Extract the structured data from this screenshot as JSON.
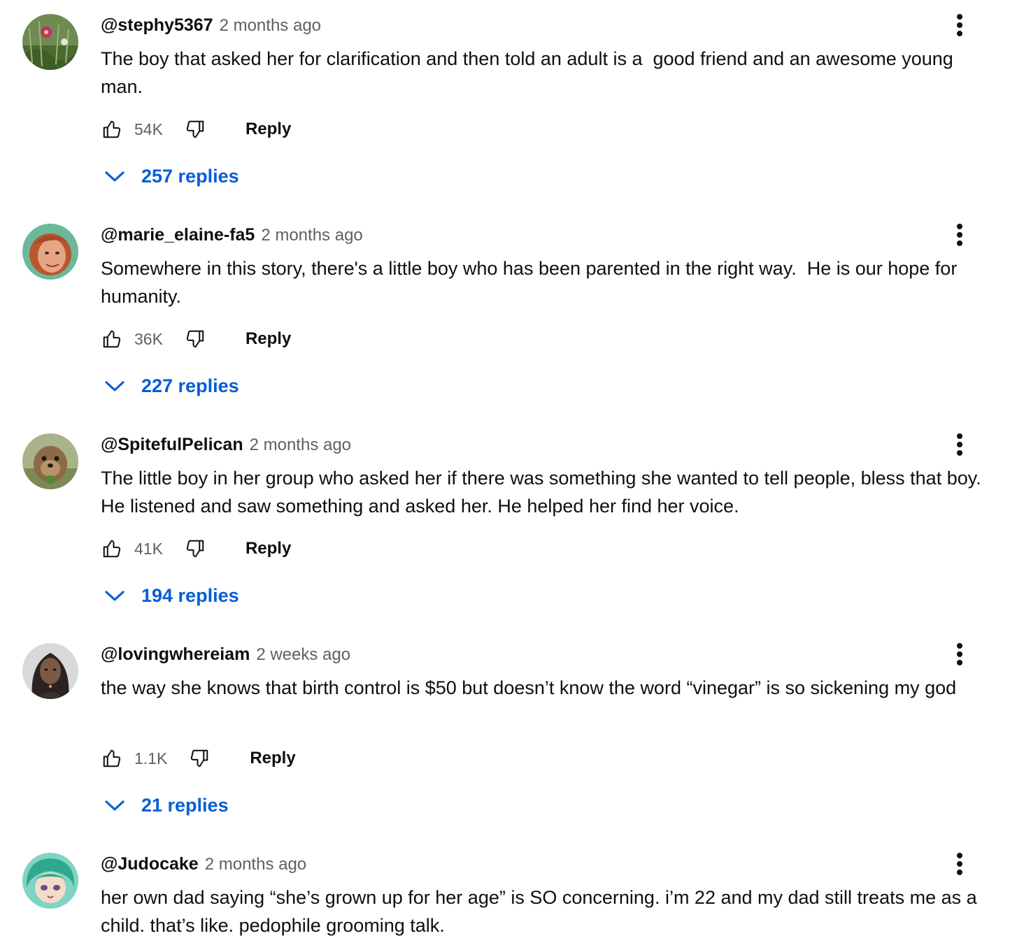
{
  "colors": {
    "text": "#0f0f0f",
    "secondary_text": "#606060",
    "link_blue": "#065fd4",
    "background": "#ffffff"
  },
  "icons": {
    "like": "thumb-up-outline",
    "dislike": "thumb-down-outline",
    "menu": "three-dot-vertical",
    "expand": "chevron-down"
  },
  "comments": [
    {
      "author": "@stephy5367",
      "time": "2 months ago",
      "text": "The boy that asked her for clarification and then told an adult is a  good friend and an awesome young man.",
      "likes": "54K",
      "reply_label": "Reply",
      "replies_label": "257 replies"
    },
    {
      "author": "@marie_elaine-fa5",
      "time": "2 months ago",
      "text": "Somewhere in this story, there's a little boy who has been parented in the right way.  He is our hope for humanity.",
      "likes": "36K",
      "reply_label": "Reply",
      "replies_label": "227 replies"
    },
    {
      "author": "@SpitefulPelican",
      "time": "2 months ago",
      "text": "The little boy in her group who asked her if there was something she wanted to tell people, bless that boy. He listened and saw something and asked her. He helped her find her voice.",
      "likes": "41K",
      "reply_label": "Reply",
      "replies_label": "194 replies"
    },
    {
      "author": "@lovingwhereiam",
      "time": "2 weeks ago",
      "text": "the way she knows that birth control is $50 but doesn’t know the word “vinegar” is so sickening my god",
      "likes": "1.1K",
      "reply_label": "Reply",
      "replies_label": "21 replies"
    },
    {
      "author": "@Judocake",
      "time": "2 months ago",
      "text": "her own dad saying “she’s grown up for her age” is SO concerning. i’m 22 and my dad still treats me as a child. that’s like. pedophile grooming talk."
    }
  ]
}
